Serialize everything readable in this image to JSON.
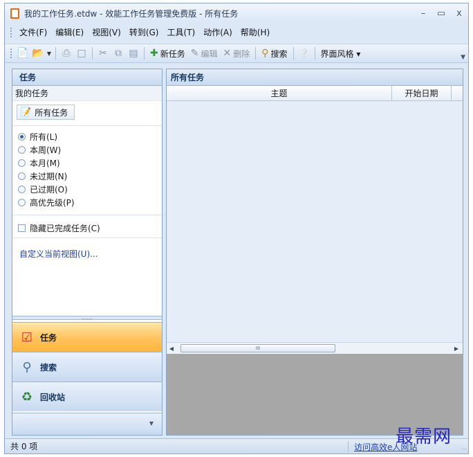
{
  "window": {
    "title": "我的工作任务.etdw - 效能工作任务管理免费版 - 所有任务"
  },
  "titlebar": {
    "minimize": "–",
    "maximize": "▭",
    "close": "x"
  },
  "menu": [
    {
      "label": "文件(F)"
    },
    {
      "label": "编辑(E)"
    },
    {
      "label": "视图(V)"
    },
    {
      "label": "转到(G)"
    },
    {
      "label": "工具(T)"
    },
    {
      "label": "动作(A)"
    },
    {
      "label": "帮助(H)"
    }
  ],
  "toolbar": {
    "new_task": "新任务",
    "edit": "编辑",
    "delete": "删除",
    "search": "搜索",
    "ui_style": "界面风格 ▾"
  },
  "left_pane": {
    "header": "任务",
    "section_label": "我的任务",
    "all_tasks_button": "所有任务",
    "filters": [
      {
        "label": "所有(L)",
        "checked": true
      },
      {
        "label": "本周(W)",
        "checked": false
      },
      {
        "label": "本月(M)",
        "checked": false
      },
      {
        "label": "未过期(N)",
        "checked": false
      },
      {
        "label": "已过期(O)",
        "checked": false
      },
      {
        "label": "高优先级(P)",
        "checked": false
      }
    ],
    "hide_completed": "隐藏已完成任务(C)",
    "customize_link": "自定义当前视图(U)..."
  },
  "nav": [
    {
      "label": "任务",
      "icon": "task-check-icon"
    },
    {
      "label": "搜索",
      "icon": "magnifier-icon"
    },
    {
      "label": "回收站",
      "icon": "recycle-bin-icon"
    }
  ],
  "right_pane": {
    "header": "所有任务",
    "columns": [
      "主题",
      "开始日期"
    ],
    "scroll_thumb": "III"
  },
  "statusbar": {
    "count": "共 0 项",
    "link": "访问高效e人网站"
  },
  "watermark": "最需网"
}
